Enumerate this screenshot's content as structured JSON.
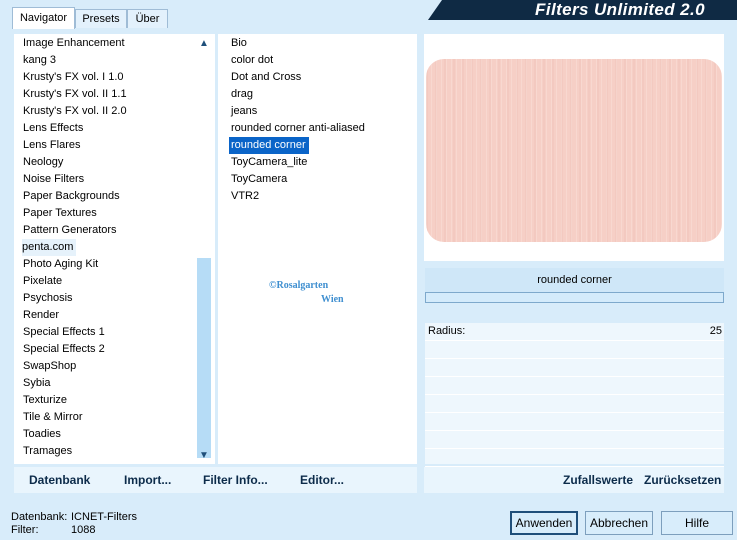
{
  "app": {
    "title": "Filters Unlimited 2.0"
  },
  "tabs": [
    {
      "label": "Navigator",
      "active": true
    },
    {
      "label": "Presets",
      "active": false
    },
    {
      "label": "Über",
      "active": false
    }
  ],
  "categories": [
    "Image Enhancement",
    "kang 3",
    "Krusty's FX vol. I 1.0",
    "Krusty's FX vol. II 1.1",
    "Krusty's FX vol. II 2.0",
    "Lens Effects",
    "Lens Flares",
    "Neology",
    "Noise Filters",
    "Paper Backgrounds",
    "Paper Textures",
    "Pattern Generators",
    "penta.com",
    "Photo Aging Kit",
    "Pixelate",
    "Psychosis",
    "Render",
    "Special Effects 1",
    "Special Effects 2",
    "SwapShop",
    "Sybia",
    "Texturize",
    "Tile & Mirror",
    "Toadies",
    "Tramages"
  ],
  "selected_category": "penta.com",
  "filters": [
    "Bio",
    "color dot",
    "Dot and Cross",
    "drag",
    "jeans",
    "rounded corner anti-aliased",
    "rounded corner",
    "ToyCamera_lite",
    "ToyCamera",
    "VTR2"
  ],
  "selected_filter": "rounded corner",
  "watermark": {
    "line1": "©Rosalgarten",
    "line2": "Wien"
  },
  "params": {
    "filter_name": "rounded corner",
    "radius_label": "Radius:",
    "radius_value": "25"
  },
  "links": {
    "datenbank": "Datenbank",
    "import": "Import...",
    "filter_info": "Filter Info...",
    "editor": "Editor...",
    "zufallswerte": "Zufallswerte",
    "zuruecksetzen": "Zurücksetzen"
  },
  "info": {
    "datenbank_label": "Datenbank:",
    "datenbank_value": "ICNET-Filters",
    "filter_label": "Filter:",
    "filter_value": "1088"
  },
  "buttons": {
    "apply": "Anwenden",
    "cancel": "Abbrechen",
    "help": "Hilfe"
  },
  "colors": {
    "accent": "#0a64c8",
    "banner": "#0f2a44",
    "preview": "#f6cfc6",
    "background": "#d8ecfa"
  }
}
